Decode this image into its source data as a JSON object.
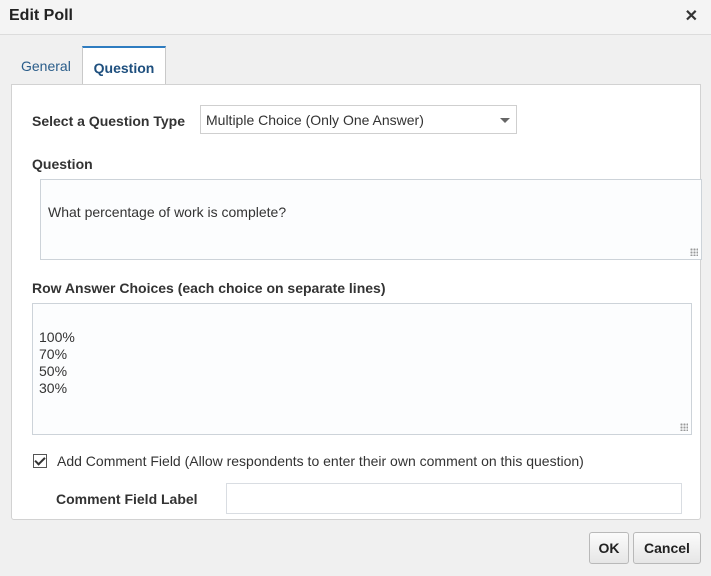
{
  "dialog": {
    "title": "Edit Poll"
  },
  "tabs": [
    {
      "label": "General"
    },
    {
      "label": "Question"
    }
  ],
  "question_type": {
    "label": "Select a Question Type",
    "value": "Multiple Choice (Only One Answer)"
  },
  "question": {
    "label": "Question",
    "value": "What percentage of work is complete?"
  },
  "answers": {
    "label": "Row Answer Choices (each choice on separate lines)",
    "value": "100%\n70%\n50%\n30%"
  },
  "comment": {
    "checkbox_label": "Add Comment Field (Allow respondents to enter their own comment on this question)",
    "checked": true,
    "field_label": "Comment Field Label",
    "field_value": ""
  },
  "buttons": {
    "ok": "OK",
    "cancel": "Cancel"
  },
  "icons": {
    "close": "close-icon",
    "dropdown": "chevron-down-icon",
    "check": "check-icon",
    "resize": "resize-handle-icon"
  }
}
